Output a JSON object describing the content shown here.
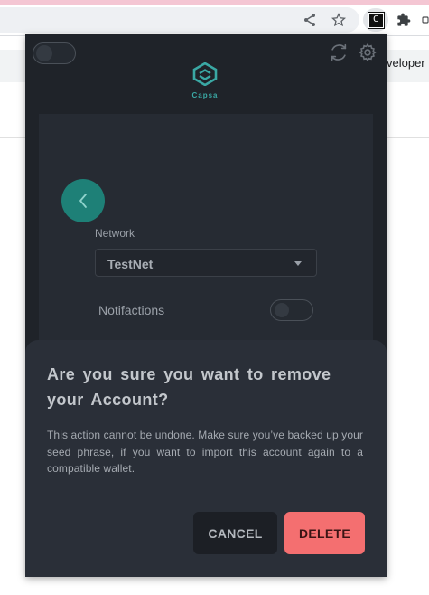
{
  "browser": {
    "behind_text": "veloper r",
    "extension_letter": "C"
  },
  "header": {
    "logo_text": "Capsa",
    "network_toggle_on": false
  },
  "settings": {
    "network_label": "Network",
    "network_value": "TestNet",
    "notifications_label": "Notifactions",
    "notifications_on": false
  },
  "dialog": {
    "title": "Are you sure you want to remove your Account?",
    "body": "This action cannot be undone. Make sure you’ve backed up your seed phrase, if you want to import this account again to a compatible wallet.",
    "cancel_label": "CANCEL",
    "delete_label": "DELETE"
  },
  "icons": [
    "share-icon",
    "bookmark-star-icon",
    "extensions-puzzle-icon",
    "refresh-icon",
    "gear-icon",
    "chevron-left-icon",
    "capsa-logo-icon",
    "dropdown-caret-icon"
  ],
  "colors": {
    "popup_bg": "#1f2329",
    "accent_teal": "#1e8077",
    "delete_red": "#f46f70",
    "dialog_bg": "#2a2f38"
  }
}
